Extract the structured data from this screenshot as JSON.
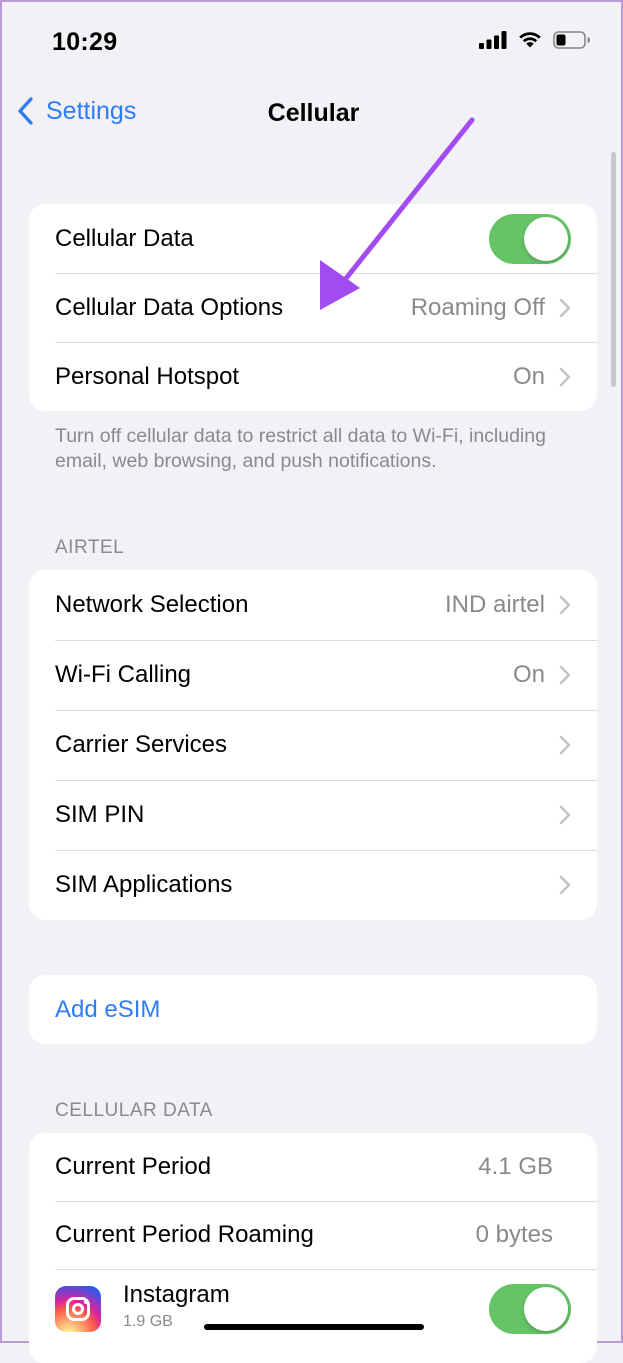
{
  "status_bar": {
    "time": "10:29"
  },
  "nav": {
    "back_label": "Settings",
    "title": "Cellular"
  },
  "group_main": {
    "cellular_data": {
      "label": "Cellular Data",
      "toggle": true
    },
    "cellular_data_options": {
      "label": "Cellular Data Options",
      "value": "Roaming Off"
    },
    "personal_hotspot": {
      "label": "Personal Hotspot",
      "value": "On"
    }
  },
  "footnote": "Turn off cellular data to restrict all data to Wi-Fi, including email, web browsing, and push notifications.",
  "section_airtel": {
    "header": "AIRTEL",
    "items": [
      {
        "label": "Network Selection",
        "value": "IND airtel"
      },
      {
        "label": "Wi-Fi Calling",
        "value": "On"
      },
      {
        "label": "Carrier Services",
        "value": ""
      },
      {
        "label": "SIM PIN",
        "value": ""
      },
      {
        "label": "SIM Applications",
        "value": ""
      }
    ]
  },
  "add_esim": {
    "label": "Add eSIM"
  },
  "section_cellular_data": {
    "header": "CELLULAR DATA",
    "current_period": {
      "label": "Current Period",
      "value": "4.1 GB"
    },
    "current_period_roaming": {
      "label": "Current Period Roaming",
      "value": "0 bytes"
    },
    "app": {
      "name": "Instagram",
      "usage": "1.9 GB",
      "toggle": true
    }
  },
  "colors": {
    "accent": "#2f7cf6",
    "toggle_on": "#65c466",
    "annotation_arrow": "#a24bf0"
  }
}
